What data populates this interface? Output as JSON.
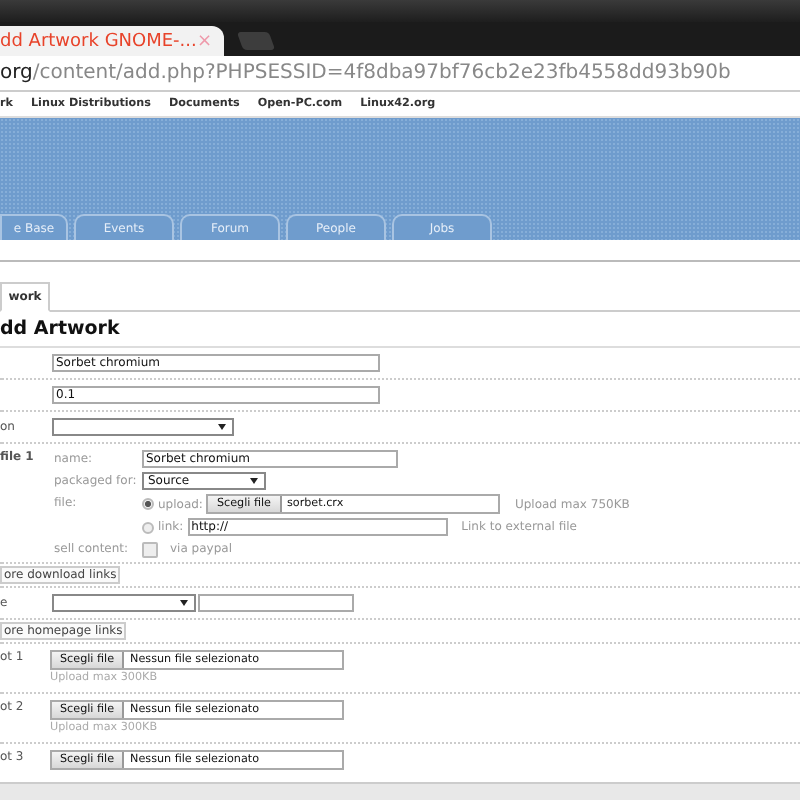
{
  "browser": {
    "tab": {
      "title": "dd Artwork GNOME-...",
      "close": "×"
    },
    "address": {
      "host": "org",
      "path": "/content/add.php?PHPSESSID=4f8dba97bf76cb2e23fb4558dd93b90b"
    },
    "bookmarks": [
      "rk",
      "Linux Distributions",
      "Documents",
      "Open-PC.com",
      "Linux42.org"
    ]
  },
  "site_nav": [
    "e Base",
    "Events",
    "Forum",
    "People",
    "Jobs"
  ],
  "page_tab": "work",
  "heading": "dd Artwork",
  "fields": [
    {
      "kind": "text",
      "value": "Sorbet chromium"
    },
    {
      "kind": "text",
      "value": "0.1"
    },
    {
      "kind": "select",
      "label": "on"
    }
  ],
  "file_block": {
    "label": "file 1",
    "name_label": "name:",
    "name_value": "Sorbet chromium",
    "packaged_label": "packaged for:",
    "packaged_value": "Source",
    "file_label": "file:",
    "upload": {
      "label": "upload:",
      "selected": true,
      "button": "Scegli file",
      "filename": "sorbet.crx",
      "hint": "Upload max 750KB"
    },
    "link": {
      "label": "link:",
      "selected": false,
      "value": "http://",
      "hint": "Link to external file"
    },
    "sell": {
      "label": "sell content:",
      "checked": false,
      "text": "via paypal"
    }
  },
  "more_download": "ore download links",
  "download_row": {
    "label": "e"
  },
  "more_homepage": "ore homepage links",
  "screenshots": [
    {
      "label": "ot 1",
      "button": "Scegli file",
      "status": "Nessun file selezionato",
      "hint": "Upload max 300KB"
    },
    {
      "label": "ot 2",
      "button": "Scegli file",
      "status": "Nessun file selezionato",
      "hint": "Upload max 300KB"
    },
    {
      "label": "ot 3",
      "button": "Scegli file",
      "status": "Nessun file selezionato"
    }
  ]
}
